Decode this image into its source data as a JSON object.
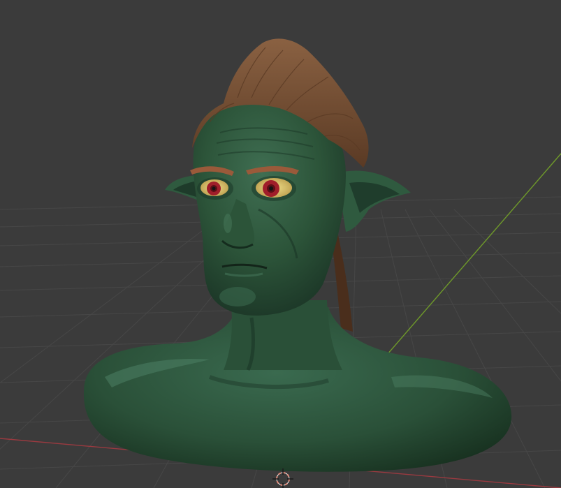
{
  "viewport": {
    "background_color": "#3b3b3b",
    "grid_color": "#4a4a4a",
    "x_axis_color": "#9a3a40",
    "y_axis_color": "#6f9a2a"
  },
  "model": {
    "skin_color": "#2f5a3f",
    "skin_shadow_color": "#1d3a29",
    "skin_highlight_color": "#4a7a5e",
    "hair_color": "#7a5236",
    "eyebrow_color": "#9a5a3a",
    "eye_sclera_color": "#e2d27a",
    "iris_color": "#a01e2a",
    "pupil_color": "#141414"
  },
  "gizmo": {
    "icon": "3d-cursor-icon",
    "color": "#e08a7a"
  }
}
